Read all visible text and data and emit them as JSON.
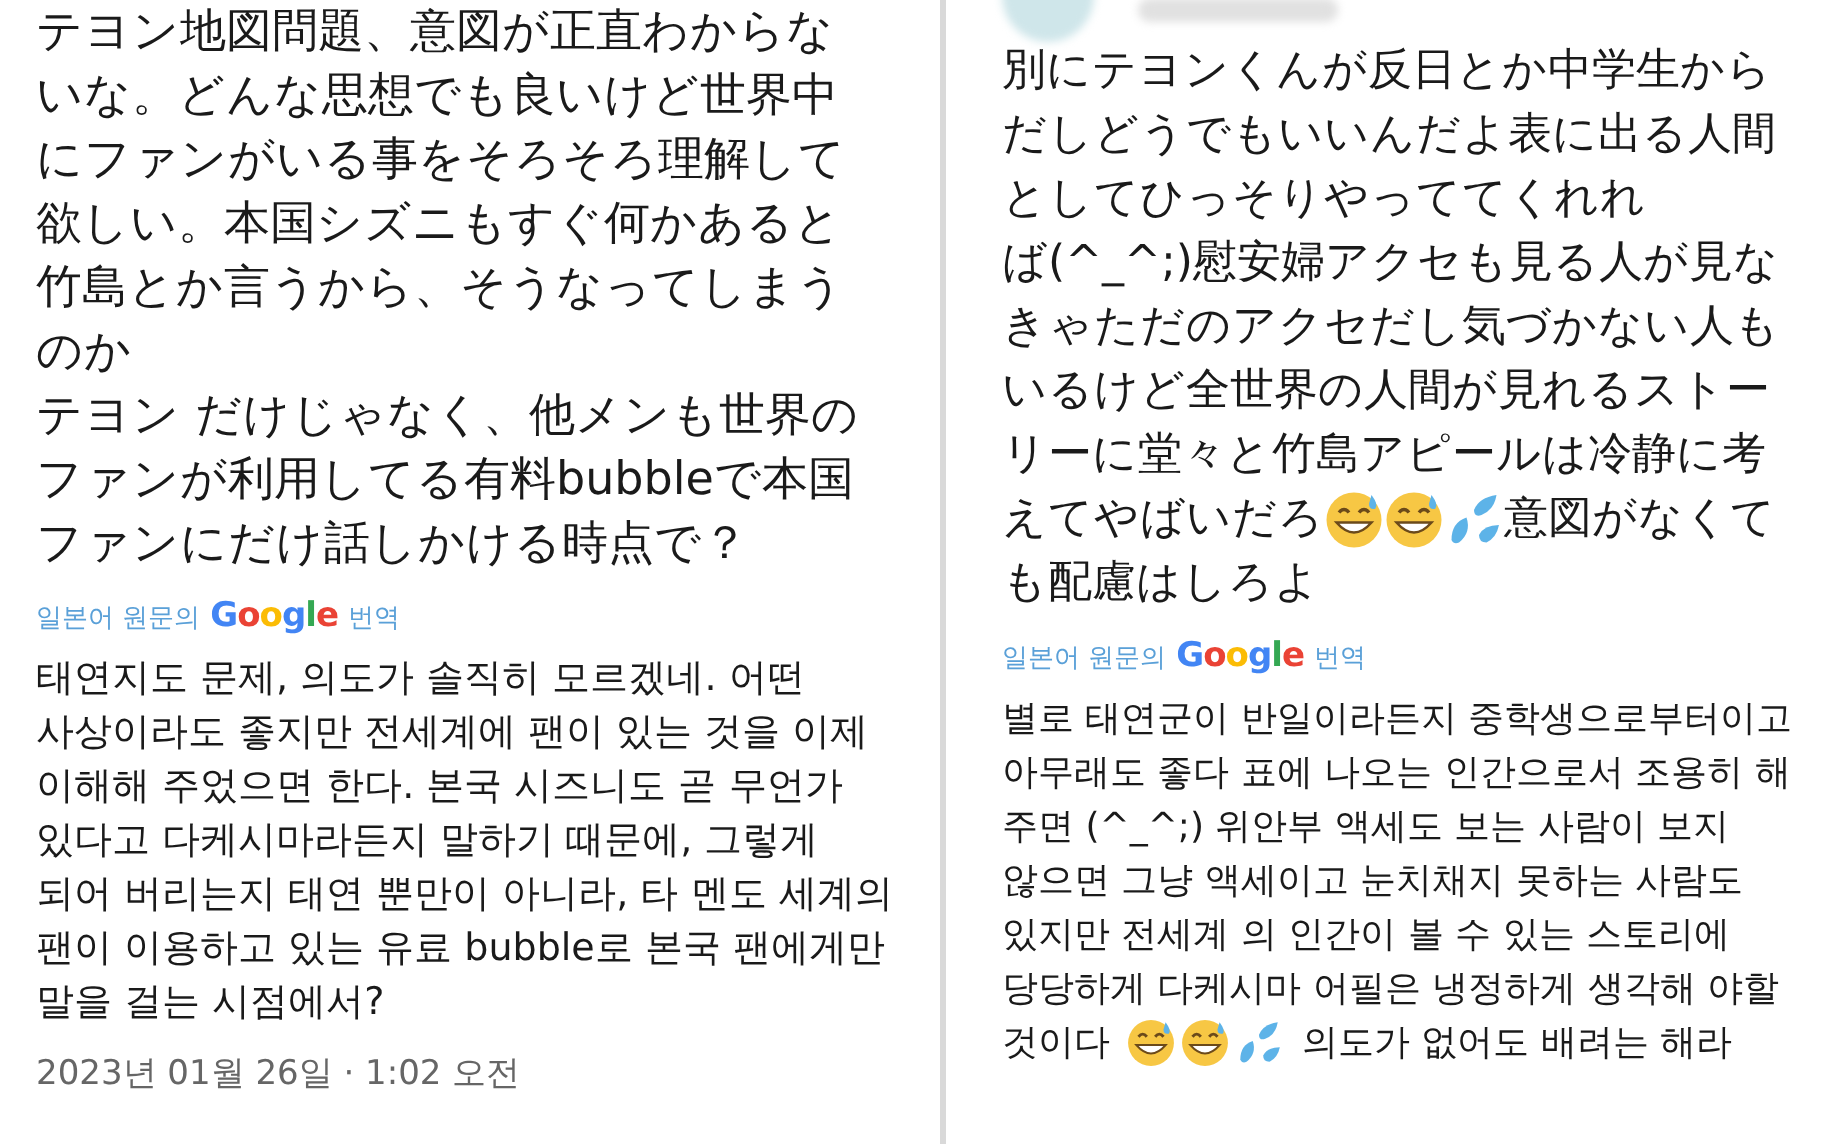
{
  "tweets": [
    {
      "text_lines": [
        "テヨン地図問題、意図が正直わからな",
        "いな。どんな思想でも良いけど世界中",
        "にファンがいる事をそろそろ理解して",
        "欲しい。本国シズニもすぐ何かあると",
        "竹島とか言うから、そうなってしまう",
        "のか",
        "テヨン だけじゃなく、他メンも世界の",
        "ファンが利用してる有料bubbleで本国",
        "ファンにだけ話しかける時点で？"
      ],
      "translation": {
        "prefix": "일본어 원문의",
        "logo": "Google",
        "suffix": "번역"
      },
      "translated_lines": [
        "태연지도 문제, 의도가 솔직히 모르겠네. 어떤",
        "사상이라도 좋지만 전세계에 팬이 있는 것을 이제",
        "이해해 주었으면 한다. 본국 시즈니도 곧 무언가",
        "있다고 다케시마라든지 말하기 때문에, 그렇게",
        "되어 버리는지 태연 뿐만이 아니라, 타 멘도 세계의",
        "팬이 이용하고 있는 유료 bubble로 본국 팬에게만",
        "말을 걸는 시점에서?"
      ],
      "timestamp": "2023년 01월 26일 · 1:02 오전"
    },
    {
      "avatar": true,
      "text_lines": [
        "別にテヨンくんが反日とか中学生から",
        "だしどうでもいいんだよ表に出る人間",
        "としてひっそりやっててくれれ",
        "ば(^_^;)慰安婦アクセも見る人が見な",
        "きゃただのアクセだし気づかない人も",
        "いるけど全世界の人間が見れるストー",
        "リーに堂々と竹島アピールは冷静に考",
        [
          {
            "kind": "text",
            "text": "えてやばいだろ"
          },
          {
            "kind": "grin"
          },
          {
            "kind": "grin"
          },
          {
            "kind": "splash"
          },
          {
            "kind": "text",
            "text": "意図がなくて"
          }
        ],
        "も配慮はしろよ"
      ],
      "translation": {
        "prefix": "일본어 원문의",
        "logo": "Google",
        "suffix": "번역"
      },
      "translated_lines": [
        "별로 태연군이 반일이라든지 중학생으로부터이고",
        "아무래도 좋다 표에 나오는 인간으로서 조용히 해",
        "주면 (^_^;) 위안부 액세도 보는 사람이 보지",
        "않으면 그냥 액세이고 눈치채지 못하는 사람도",
        "있지만 전세계 의 인간이 볼 수 있는 스토리에",
        "당당하게 다케시마 어필은 냉정하게 생각해 야할",
        [
          {
            "kind": "text",
            "text": "것이다"
          },
          {
            "kind": "grin"
          },
          {
            "kind": "grin"
          },
          {
            "kind": "splash"
          },
          {
            "kind": "text",
            "text": "의도가 없어도 배려는 해라"
          }
        ]
      ]
    }
  ]
}
